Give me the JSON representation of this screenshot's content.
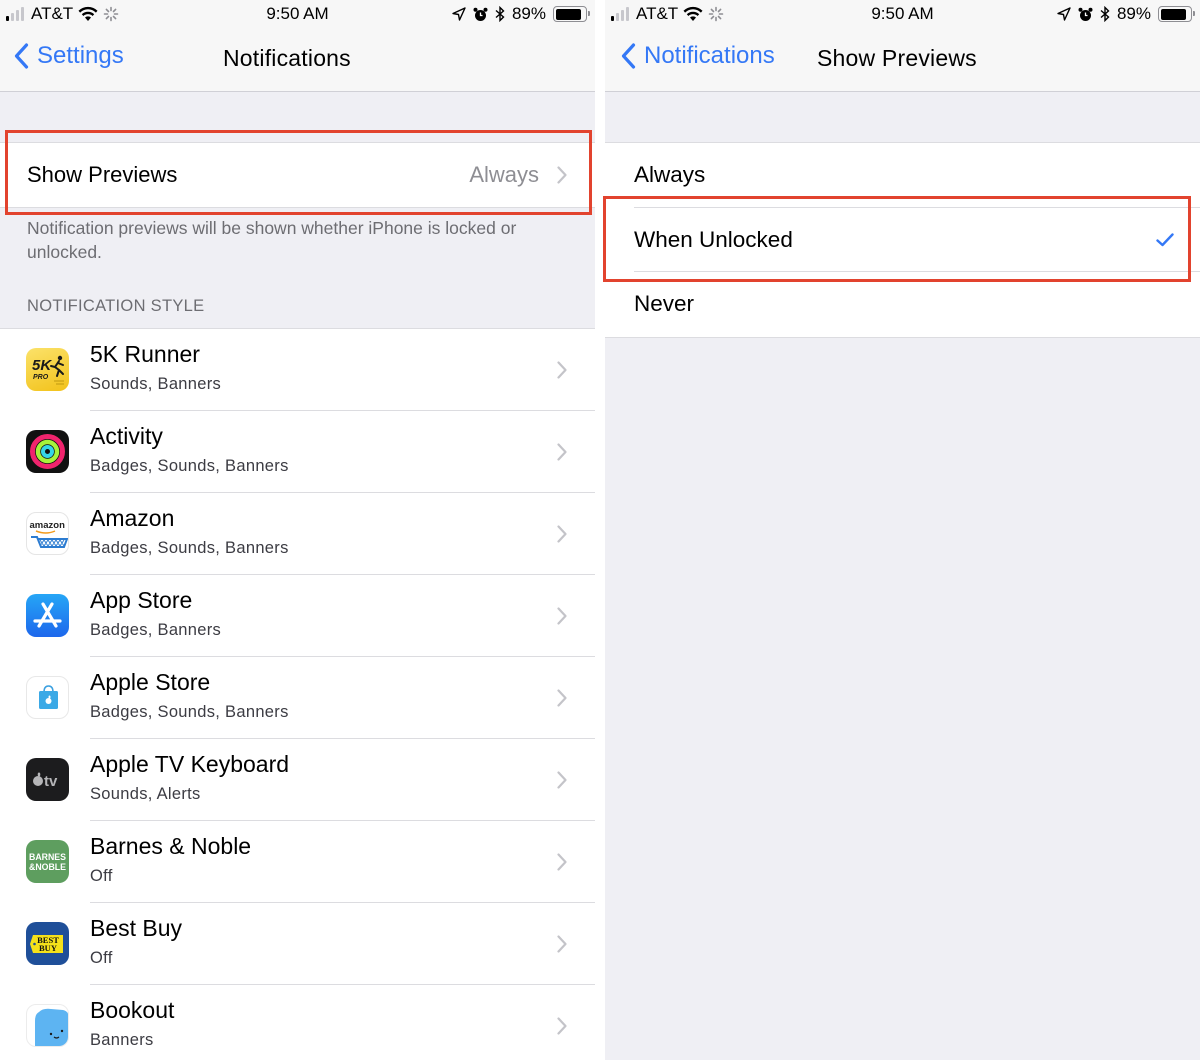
{
  "status_bar": {
    "carrier": "AT&T",
    "time": "9:50 AM",
    "battery": "89%",
    "battery_level": 0.89,
    "signal_bars_on": 1,
    "signal_bars_total": 4
  },
  "left": {
    "nav": {
      "back_label": "Settings",
      "title": "Notifications"
    },
    "show_previews": {
      "label": "Show Previews",
      "value": "Always"
    },
    "footer": "Notification previews will be shown whether iPhone is locked or unlocked.",
    "section_header": "NOTIFICATION STYLE",
    "apps": [
      {
        "name": "5K Runner",
        "subtitle": "Sounds, Banners",
        "icon": "5k-runner-icon"
      },
      {
        "name": "Activity",
        "subtitle": "Badges, Sounds, Banners",
        "icon": "activity-icon"
      },
      {
        "name": "Amazon",
        "subtitle": "Badges, Sounds, Banners",
        "icon": "amazon-icon"
      },
      {
        "name": "App Store",
        "subtitle": "Badges, Banners",
        "icon": "app-store-icon"
      },
      {
        "name": "Apple Store",
        "subtitle": "Badges, Sounds, Banners",
        "icon": "apple-store-icon"
      },
      {
        "name": "Apple TV Keyboard",
        "subtitle": "Sounds, Alerts",
        "icon": "apple-tv-icon"
      },
      {
        "name": "Barnes & Noble",
        "subtitle": "Off",
        "icon": "barnes-noble-icon"
      },
      {
        "name": "Best Buy",
        "subtitle": "Off",
        "icon": "best-buy-icon"
      },
      {
        "name": "Bookout",
        "subtitle": "Banners",
        "icon": "bookout-icon"
      }
    ],
    "icon_text": {
      "fivek": "5K",
      "pro": "PRO",
      "amazon": "amazon",
      "tv": "tv",
      "bn_line1": "BARNES",
      "bn_line2": "&NOBLE",
      "bb_line1": "BEST",
      "bb_line2": "BUY"
    }
  },
  "right": {
    "nav": {
      "back_label": "Notifications",
      "title": "Show Previews"
    },
    "options": [
      {
        "label": "Always",
        "selected": false
      },
      {
        "label": "When Unlocked",
        "selected": true
      },
      {
        "label": "Never",
        "selected": false
      }
    ]
  },
  "colors": {
    "accent": "#3478f6",
    "highlight": "#e2432e",
    "grouped_bg": "#efeff4"
  }
}
